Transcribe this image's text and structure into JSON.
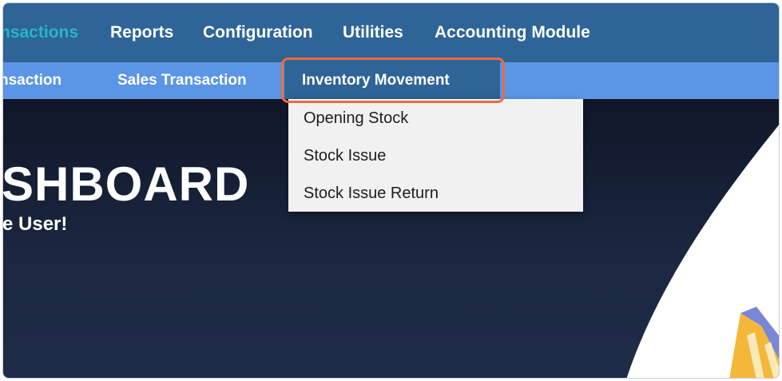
{
  "topnav": {
    "items": [
      {
        "label": "nsactions",
        "active": true
      },
      {
        "label": "Reports"
      },
      {
        "label": "Configuration"
      },
      {
        "label": "Utilities"
      },
      {
        "label": "Accounting Module"
      }
    ],
    "background": "#2e6496",
    "active_color": "#25b6c9"
  },
  "subnav": {
    "items": [
      {
        "label": "nsaction"
      },
      {
        "label": "Sales Transaction"
      },
      {
        "label": "Inventory Movement",
        "selected": true
      }
    ],
    "background": "#5b95e6",
    "highlight_color": "#ee6c3a"
  },
  "dropdown": {
    "items": [
      {
        "label": "Opening Stock"
      },
      {
        "label": "Stock Issue"
      },
      {
        "label": "Stock Issue Return"
      }
    ]
  },
  "hero": {
    "title": "SHBOARD",
    "subtitle": "e User!"
  }
}
